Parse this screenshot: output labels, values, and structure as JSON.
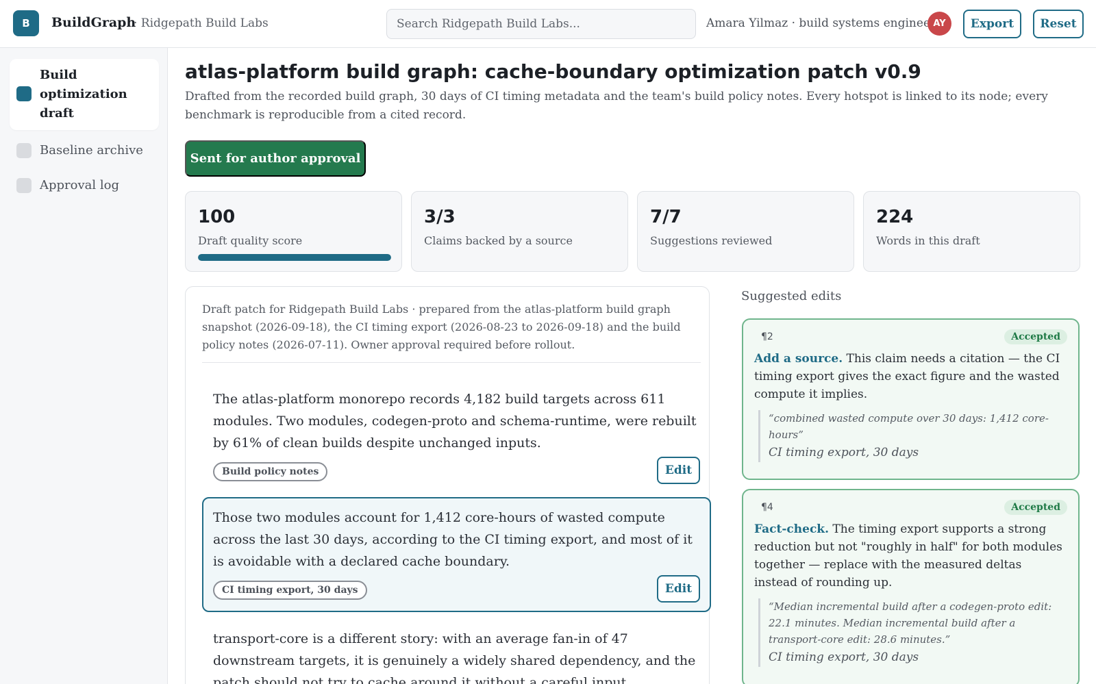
{
  "header": {
    "logo_letter": "B",
    "brand": "BuildGraph",
    "org": "· Ridgepath Build Labs",
    "search_placeholder": "Search Ridgepath Build Labs...",
    "user": "Amara Yilmaz · build systems engineer",
    "avatar_initials": "AY",
    "export_label": "Export",
    "reset_label": "Reset"
  },
  "sidebar": {
    "items": [
      {
        "label": "Build optimization draft",
        "active": true
      },
      {
        "label": "Baseline archive",
        "active": false
      },
      {
        "label": "Approval log",
        "active": false
      }
    ]
  },
  "main": {
    "title": "atlas-platform build graph: cache-boundary optimization patch v0.9",
    "subtitle": "Drafted from the recorded build graph, 30 days of CI timing metadata and the team's build policy notes. Every hotspot is linked to its node; every benchmark is reproducible from a cited record.",
    "status_label": "Sent for author approval"
  },
  "stats": [
    {
      "value": "100",
      "label": "Draft quality score",
      "progress": 1.0
    },
    {
      "value": "3/3",
      "label": "Claims backed by a source"
    },
    {
      "value": "7/7",
      "label": "Suggestions reviewed"
    },
    {
      "value": "224",
      "label": "Words in this draft"
    }
  ],
  "draft": {
    "meta": "Draft patch for Ridgepath Build Labs · prepared from the atlas-platform build graph snapshot (2026-09-18), the CI timing export (2026-08-23 to 2026-09-18) and the build policy notes (2026-07-11). Owner approval required before rollout.",
    "paragraphs": [
      {
        "text": "The atlas-platform monorepo records 4,182 build targets across 611 modules. Two modules, codegen-proto and schema-runtime, were rebuilt by 61% of clean builds despite unchanged inputs.",
        "source": "Build policy notes",
        "edit_label": "Edit"
      },
      {
        "text": "Those two modules account for 1,412 core-hours of wasted compute across the last 30 days, according to the CI timing export, and most of it is avoidable with a declared cache boundary.",
        "source": "CI timing export, 30 days",
        "edit_label": "Edit"
      },
      {
        "text": "transport-core is a different story: with an average fan-in of 47 downstream targets, it is genuinely a widely shared dependency, and the patch should not try to cache around it without a careful input declaration."
      }
    ]
  },
  "suggestions": {
    "title": "Suggested edits",
    "cards": [
      {
        "num": "¶2",
        "status": "Accepted",
        "keyword": "Add a source.",
        "body": " This claim needs a citation — the CI timing export gives the exact figure and the wasted compute it implies.",
        "quote": "“combined wasted compute over 30 days: 1,412 core-hours”",
        "source": "CI timing export, 30 days"
      },
      {
        "num": "¶4",
        "status": "Accepted",
        "keyword": "Fact-check.",
        "body": " The timing export supports a strong reduction but not \"roughly in half\" for both modules together — replace with the measured deltas instead of rounding up.",
        "quote": "“Median incremental build after a codegen-proto edit: 22.1 minutes. Median incremental build after a transport-core edit: 28.6 minutes.”",
        "source": "CI timing export, 30 days"
      }
    ]
  },
  "colors": {
    "accent": "#1f6b86",
    "approve": "#247a4e",
    "accepted_border": "#6fb58c",
    "avatar": "#c9474a"
  }
}
